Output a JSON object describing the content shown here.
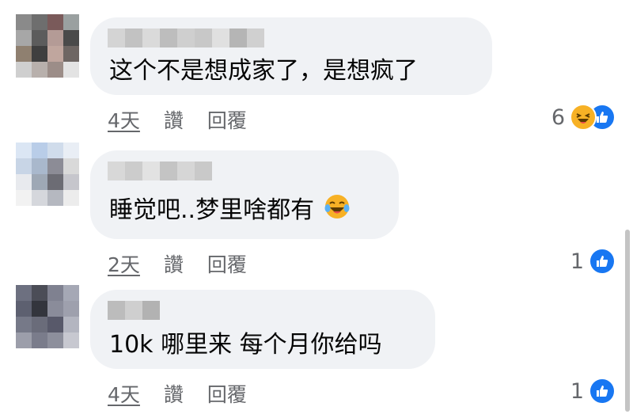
{
  "comments": [
    {
      "text": "这个不是想成家了，是想疯了",
      "time": "4天",
      "like_label": "讚",
      "reply_label": "回覆",
      "reaction_count": "6",
      "reactions": [
        "haha-icon",
        "like-icon"
      ],
      "avatar_colors": [
        "#8a8a8a",
        "#6e6e6e",
        "#7a5a5a",
        "#9aa0a0",
        "#a7a7a7",
        "#5c5c5c",
        "#b49b96",
        "#4a4a4a",
        "#8f8070",
        "#3f3f3f",
        "#c0a69e",
        "#6e6663",
        "#cfcfcf",
        "#b8b0ac",
        "#9c8d88",
        "#e3e3e3"
      ]
    },
    {
      "text": "睡觉吧..梦里啥都有",
      "emoji": "tears-of-joy",
      "time": "2天",
      "like_label": "讚",
      "reply_label": "回覆",
      "reaction_count": "1",
      "reactions": [
        "like-icon"
      ],
      "avatar_colors": [
        "#dbe6f4",
        "#b9cde8",
        "#d0dceb",
        "#e9eef5",
        "#c8d5e6",
        "#a9b8cc",
        "#8c8c96",
        "#d9d9d9",
        "#e8eaee",
        "#9ea8b5",
        "#6c6c74",
        "#c6c6cc",
        "#f2f2f2",
        "#d5d7dc",
        "#b5b8c0",
        "#ececec"
      ]
    },
    {
      "text": "10k 哪里来 每个月你给吗",
      "time": "4天",
      "like_label": "讚",
      "reply_label": "回覆",
      "reaction_count": "1",
      "reactions": [
        "like-icon"
      ],
      "avatar_colors": [
        "#6d7080",
        "#4b4d57",
        "#7f8190",
        "#a5a8b5",
        "#5d6070",
        "#33353d",
        "#8a8c9a",
        "#9ea0ad",
        "#767988",
        "#6a6c7a",
        "#58596a",
        "#b3b5c0",
        "#9c9eaa",
        "#7a7c8b",
        "#8d8f9c",
        "#c7c8d0"
      ]
    }
  ],
  "colors": {
    "bubble": "#f0f2f5",
    "meta": "#65676b",
    "like_blue": "#1877f2",
    "haha_yellow": "#f7b125"
  }
}
